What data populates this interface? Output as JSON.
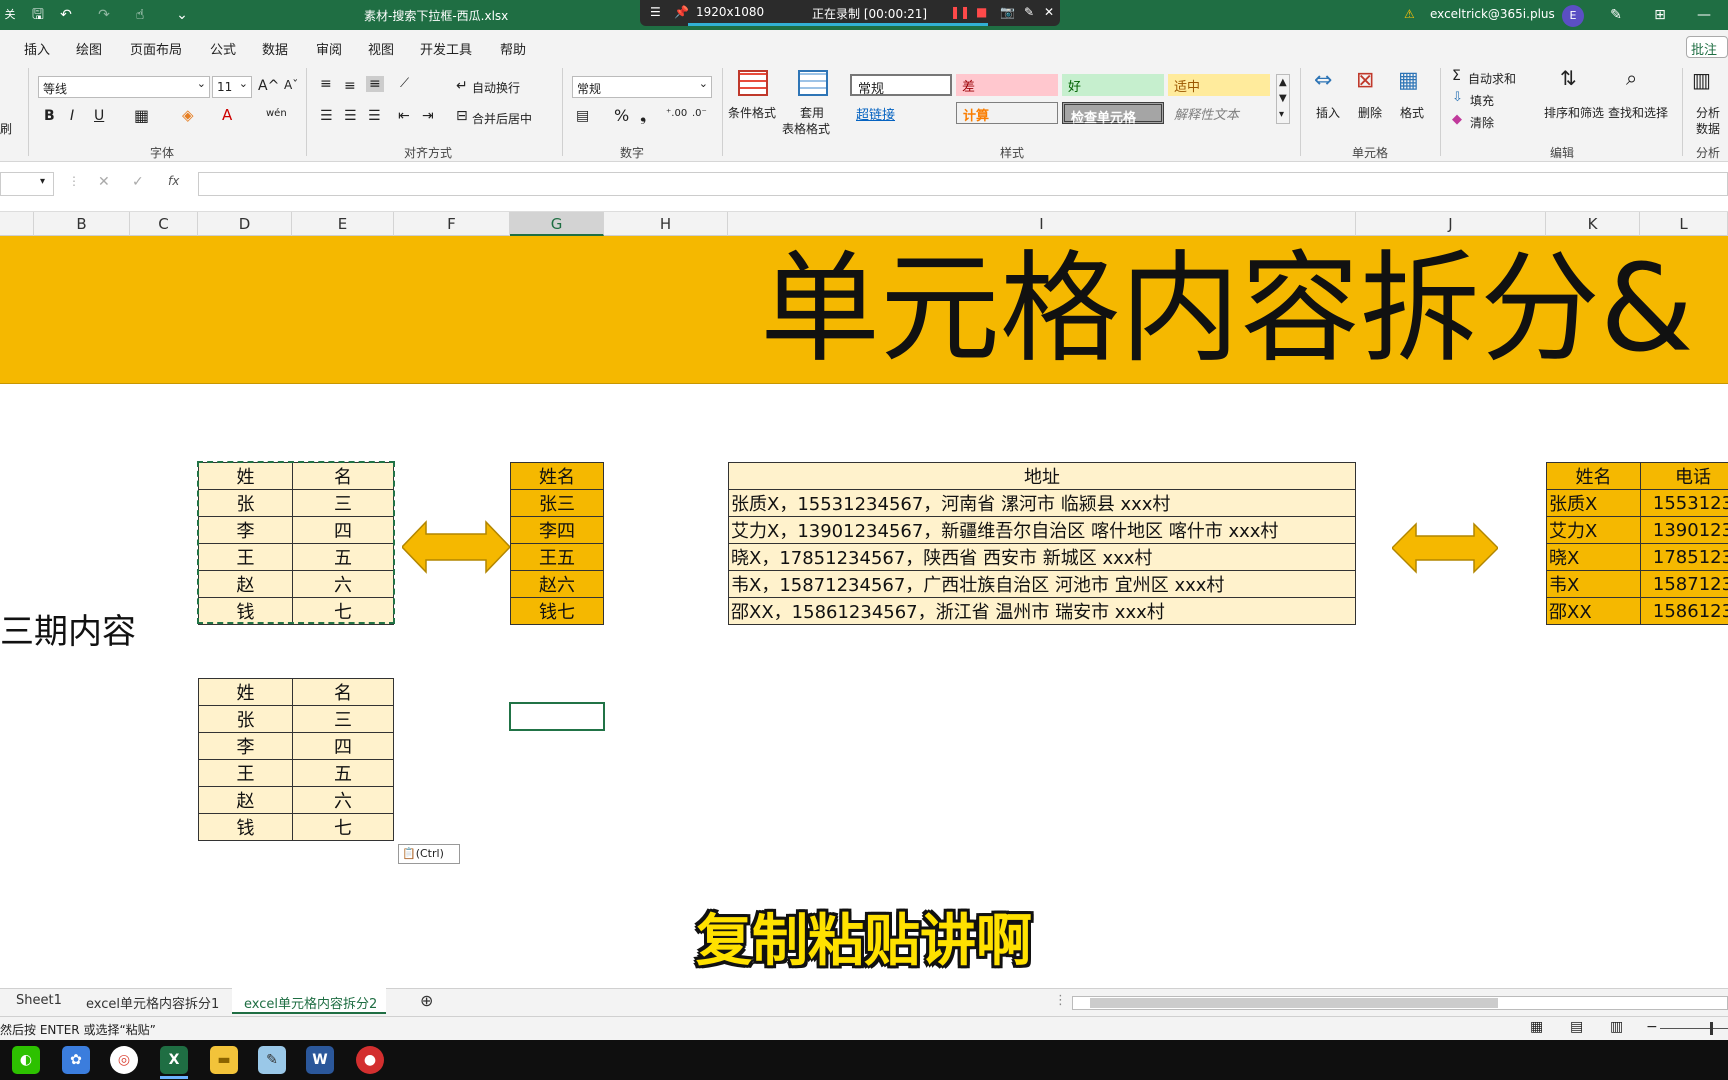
{
  "titlebar": {
    "quick_autosave": "关",
    "filename": "素材-搜索下拉框-西瓜.xlsx",
    "account": "exceltrick@365i.plus",
    "avatar_letter": "E",
    "recorder": {
      "resolution": "1920x1080",
      "status": "正在录制 [00:00:21]"
    }
  },
  "menu": [
    "插入",
    "绘图",
    "页面布局",
    "公式",
    "数据",
    "审阅",
    "视图",
    "开发工具",
    "帮助"
  ],
  "menu_right": "批注",
  "ribbon": {
    "font_name": "等线",
    "font_size": "11",
    "font_group": "字体",
    "align_group": "对齐方式",
    "wrap_text": "自动换行",
    "merge_center": "合并后居中",
    "number_format": "常规",
    "number_group": "数字",
    "cond_format": "条件格式",
    "table_format_1": "套用",
    "table_format_2": "表格格式",
    "styles": [
      {
        "label": "常规",
        "bg": "#ffffff",
        "fg": "#222222"
      },
      {
        "label": "差",
        "bg": "#ffc7ce",
        "fg": "#9c0006"
      },
      {
        "label": "好",
        "bg": "#c6efce",
        "fg": "#006100"
      },
      {
        "label": "适中",
        "bg": "#ffeb9c",
        "fg": "#9c5700"
      },
      {
        "label": "超链接",
        "bg": "#f3f3f3",
        "fg": "#0563c1"
      },
      {
        "label": "计算",
        "bg": "#f2f2f2",
        "fg": "#fa7d00"
      },
      {
        "label": "检查单元格",
        "bg": "#a5a5a5",
        "fg": "#ffffff"
      },
      {
        "label": "解释性文本",
        "bg": "#f3f3f3",
        "fg": "#7f7f7f"
      }
    ],
    "styles_group": "样式",
    "insert": "插入",
    "delete": "删除",
    "format": "格式",
    "cells_group": "单元格",
    "autosum": "自动求和",
    "fill": "填充",
    "clear": "清除",
    "sort_filter": "排序和筛选",
    "find_select": "查找和选择",
    "edit_group": "编辑",
    "analyze_1": "分析",
    "analyze_2": "数据",
    "analysis_group": "分析",
    "left_paste": "刷"
  },
  "formula_bar": {
    "fx": "fx"
  },
  "columns": [
    "B",
    "C",
    "D",
    "E",
    "F",
    "G",
    "H",
    "I",
    "J",
    "K",
    "L"
  ],
  "banner_title": "单元格内容拆分&",
  "side_text": "三期内容",
  "table_split_top": {
    "header": [
      "姓",
      "名"
    ],
    "rows": [
      [
        "张",
        "三"
      ],
      [
        "李",
        "四"
      ],
      [
        "王",
        "五"
      ],
      [
        "赵",
        "六"
      ],
      [
        "钱",
        "七"
      ]
    ]
  },
  "table_split_bottom": {
    "header": [
      "姓",
      "名"
    ],
    "rows": [
      [
        "张",
        "三"
      ],
      [
        "李",
        "四"
      ],
      [
        "王",
        "五"
      ],
      [
        "赵",
        "六"
      ],
      [
        "钱",
        "七"
      ]
    ]
  },
  "table_names": {
    "header": "姓名",
    "rows": [
      "张三",
      "李四",
      "王五",
      "赵六",
      "钱七"
    ]
  },
  "table_address": {
    "header": "地址",
    "rows": [
      "张质X，15531234567，河南省 漯河市 临颍县 xxx村",
      "艾力X，13901234567，新疆维吾尔自治区 喀什地区 喀什市 xxx村",
      "晓X，17851234567，陕西省 西安市 新城区 xxx村",
      "韦X，15871234567，广西壮族自治区 河池市 宜州区 xxx村",
      "邵XX，15861234567，浙江省 温州市 瑞安市 xxx村"
    ]
  },
  "table_right": {
    "header": [
      "姓名",
      "电话"
    ],
    "rows": [
      [
        "张质X",
        "1553123"
      ],
      [
        "艾力X",
        "1390123"
      ],
      [
        "晓X",
        "1785123"
      ],
      [
        "韦X",
        "1587123"
      ],
      [
        "邵XX",
        "1586123"
      ]
    ]
  },
  "paste_tag": "(Ctrl)",
  "subtitle": "复制粘贴讲啊",
  "sheet_tabs": [
    "Sheet1",
    "excel单元格内容拆分1",
    "excel单元格内容拆分2"
  ],
  "status_text": "然后按 ENTER 或选择“粘贴”",
  "colors": {
    "excel_green": "#1f6e43",
    "banner": "#f5b800",
    "cream": "#fff2cc"
  }
}
